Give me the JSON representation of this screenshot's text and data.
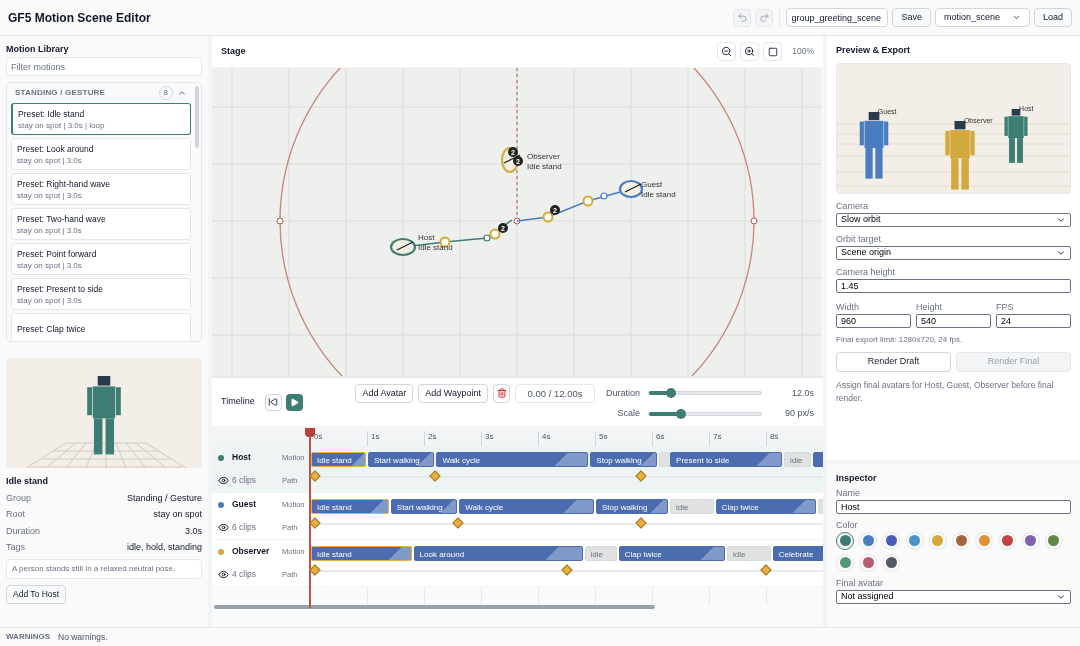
{
  "app": {
    "title": "GF5 Motion Scene Editor"
  },
  "toolbar": {
    "scene_name": "group_greeting_scene",
    "save": "Save",
    "scene_type": "motion_scene",
    "load": "Load"
  },
  "library": {
    "title": "Motion Library",
    "filter_placeholder": "Filter motions",
    "group": {
      "label": "STANDING / GESTURE",
      "count": "8",
      "expanded": true
    },
    "items": [
      {
        "title": "Preset: Idle stand",
        "meta": "stay on spot | 3.0s | loop",
        "selected": true
      },
      {
        "title": "Preset: Look around",
        "meta": "stay on spot | 3.0s",
        "selected": false
      },
      {
        "title": "Preset: Right-hand wave",
        "meta": "stay on spot | 3.0s",
        "selected": false
      },
      {
        "title": "Preset: Two-hand wave",
        "meta": "stay on spot | 3.0s",
        "selected": false
      },
      {
        "title": "Preset: Point forward",
        "meta": "stay on spot | 3.0s",
        "selected": false
      },
      {
        "title": "Preset: Present to side",
        "meta": "stay on spot | 3.0s",
        "selected": false
      },
      {
        "title": "Preset: Clap twice",
        "selected": false
      }
    ]
  },
  "details": {
    "name": "Idle stand",
    "fields": [
      {
        "label": "Group",
        "value": "Standing / Gesture"
      },
      {
        "label": "Root",
        "value": "stay on spot"
      },
      {
        "label": "Duration",
        "value": "3.0s"
      },
      {
        "label": "Tags",
        "value": "idle, hold, standing"
      }
    ],
    "description": "A person stands still in a relaxed neutral pose.",
    "add_button": "Add To Host"
  },
  "stage": {
    "title": "Stage",
    "zoom": "100%",
    "markers": [
      {
        "name": "Host",
        "motion": "Idle stand",
        "color": "#3d7d74",
        "badges": [
          "2"
        ]
      },
      {
        "name": "Guest",
        "motion": "Idle stand",
        "color": "#4a7cc0",
        "badges": [
          "2"
        ]
      },
      {
        "name": "Observer",
        "motion": "Idle stand",
        "color": "#d4a93c",
        "badges": [
          "2",
          "2"
        ]
      }
    ]
  },
  "timeline": {
    "title": "Timeline",
    "add_avatar": "Add Avatar",
    "add_waypoint": "Add Waypoint",
    "time": "0.00 / 12.00s",
    "duration": {
      "label": "Duration",
      "level": 0.2,
      "reading": "12.0s"
    },
    "scale": {
      "label": "Scale",
      "level": 0.29,
      "reading": "90 px/s"
    },
    "ticks": [
      "0s",
      "1s",
      "2s",
      "3s",
      "4s",
      "5s",
      "6s",
      "7s",
      "8s"
    ],
    "tracks": [
      {
        "name": "Host",
        "color": "#3d7d74",
        "visible": true,
        "selected": true,
        "clips_count": "6 clips",
        "motion_label": "Motion",
        "path_label": "Path",
        "clips": [
          {
            "kind": "motion",
            "label": "Idle stand",
            "selected": true
          },
          {
            "kind": "motion",
            "label": "Start walking",
            "selected": false
          },
          {
            "kind": "motion",
            "label": "Walk cycle",
            "selected": false
          },
          {
            "kind": "motion",
            "label": "Stop walking",
            "selected": false
          },
          {
            "kind": "idle",
            "selected": false
          },
          {
            "kind": "motion",
            "label": "Present to side",
            "selected": false
          },
          {
            "kind": "idle",
            "label": "idle",
            "selected": false
          },
          {
            "kind": "motion",
            "selected": false
          }
        ]
      },
      {
        "name": "Guest",
        "color": "#4a7cc0",
        "visible": true,
        "selected": false,
        "clips_count": "6 clips",
        "motion_label": "Motion",
        "path_label": "Path",
        "clips": [
          {
            "kind": "motion",
            "label": "Idle stand",
            "selected": true
          },
          {
            "kind": "motion",
            "label": "Start walking",
            "selected": false
          },
          {
            "kind": "motion",
            "label": "Walk cycle",
            "selected": false
          },
          {
            "kind": "motion",
            "label": "Stop walking",
            "selected": false
          },
          {
            "kind": "idle",
            "label": "idle",
            "selected": false
          },
          {
            "kind": "motion",
            "label": "Clap twice",
            "selected": false
          },
          {
            "kind": "idle",
            "selected": false
          }
        ]
      },
      {
        "name": "Observer",
        "color": "#d4a93c",
        "visible": true,
        "selected": false,
        "clips_count": "4 clips",
        "motion_label": "Motion",
        "path_label": "Path",
        "clips": [
          {
            "kind": "motion",
            "label": "Idle stand",
            "selected": true
          },
          {
            "kind": "motion",
            "label": "Look around",
            "selected": false
          },
          {
            "kind": "idle",
            "label": "idle",
            "selected": false
          },
          {
            "kind": "motion",
            "label": "Clap twice",
            "selected": false
          },
          {
            "kind": "idle",
            "label": "idle",
            "selected": false
          },
          {
            "kind": "motion",
            "label": "Celebrate",
            "selected": false
          }
        ]
      }
    ]
  },
  "preview": {
    "title": "Preview & Export",
    "figures": [
      {
        "name": "Guest",
        "color": "#4a7cc0"
      },
      {
        "name": "Observer",
        "color": "#d4a93c"
      },
      {
        "name": "Host",
        "color": "#3d7d74"
      }
    ],
    "camera": {
      "label": "Camera",
      "value": "Slow orbit"
    },
    "orbit": {
      "label": "Orbit target",
      "value": "Scene origin"
    },
    "height": {
      "label": "Camera height",
      "value": "1.45"
    },
    "dims": [
      {
        "label": "Width",
        "value": "960"
      },
      {
        "label": "Height",
        "value": "540"
      },
      {
        "label": "FPS",
        "value": "24"
      }
    ],
    "limit": "Final export limit: 1280x720, 24 fps.",
    "render_draft": {
      "label": "Render Draft",
      "disabled": false
    },
    "render_final": {
      "label": "Render Final",
      "disabled": true
    },
    "note": "Assign final avatars for Host, Guest, Observer before final render."
  },
  "inspector": {
    "title": "Inspector",
    "name_label": "Name",
    "name": "Host",
    "color_label": "Color",
    "swatches": [
      {
        "color": "#3d7d74",
        "selected": true
      },
      {
        "color": "#4a7cc0",
        "selected": false
      },
      {
        "color": "#4b5bb8",
        "selected": false
      },
      {
        "color": "#4a93c8",
        "selected": false
      },
      {
        "color": "#d4a93c",
        "selected": false
      },
      {
        "color": "#a8643a",
        "selected": false
      },
      {
        "color": "#dd913a",
        "selected": false
      },
      {
        "color": "#c1443f",
        "selected": false
      },
      {
        "color": "#7e62ad",
        "selected": false
      },
      {
        "color": "#5e8a48",
        "selected": false
      },
      {
        "color": "#4f9a72",
        "selected": false
      },
      {
        "color": "#b85b72",
        "selected": false
      },
      {
        "color": "#4f5a66",
        "selected": false
      }
    ],
    "avatar_label": "Final avatar",
    "avatar": "Not assigned"
  },
  "status_bar": {
    "label": "WARNINGS",
    "message": "No warnings."
  }
}
